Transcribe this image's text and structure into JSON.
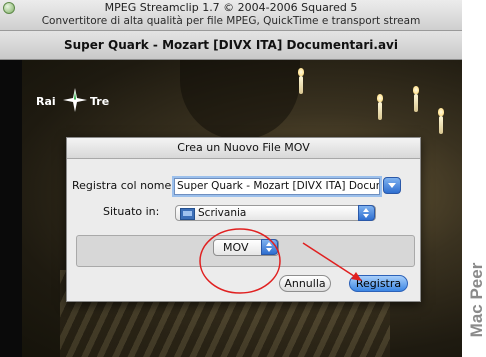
{
  "window": {
    "title_line1": "MPEG Streamclip 1.7  ©  2004-2006 Squared 5",
    "title_line2": "Convertitore di alta qualità per file MPEG, QuickTime e transport stream",
    "file_name": "Super Quark - Mozart [DIVX ITA] Documentari.avi"
  },
  "video": {
    "channel_logo_left": "Rai",
    "channel_logo_right": "Tre"
  },
  "dialog": {
    "title": "Crea un Nuovo File MOV",
    "save_as_label": "Registra col nome:",
    "save_as_value": "Super Quark - Mozart [DIVX ITA] Documentari.mov",
    "where_label": "Situato in:",
    "where_value": "Scrivania",
    "format_value": "MOV",
    "cancel_label": "Annulla",
    "save_label": "Registra"
  },
  "annotation_color": "#e02020",
  "watermark": "Mac Peer"
}
